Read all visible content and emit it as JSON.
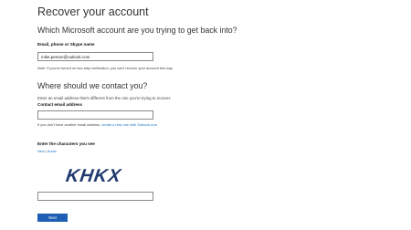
{
  "page": {
    "title": "Recover your account",
    "subtitle": "Which Microsoft account are you trying to get back into?"
  },
  "account": {
    "label": "Email, phone or Skype name",
    "value": "mike.person@outlook.com",
    "note": "Note: If you've turned on two-step verification, you can't recover your account this way"
  },
  "contact": {
    "heading": "Where should we contact you?",
    "instructions": "Enter an email address that's different from the one you're trying to recover.",
    "label": "Contact email address",
    "value": "",
    "hint_prefix": "If you don't have another email address,",
    "hint_link": "create a new one with Outlook.com"
  },
  "captcha": {
    "label": "Enter the characters you see",
    "new_link": "New",
    "separator": "|",
    "audio_link": "Audio",
    "image_text": "KHKX",
    "value": ""
  },
  "actions": {
    "next_label": "Next"
  }
}
